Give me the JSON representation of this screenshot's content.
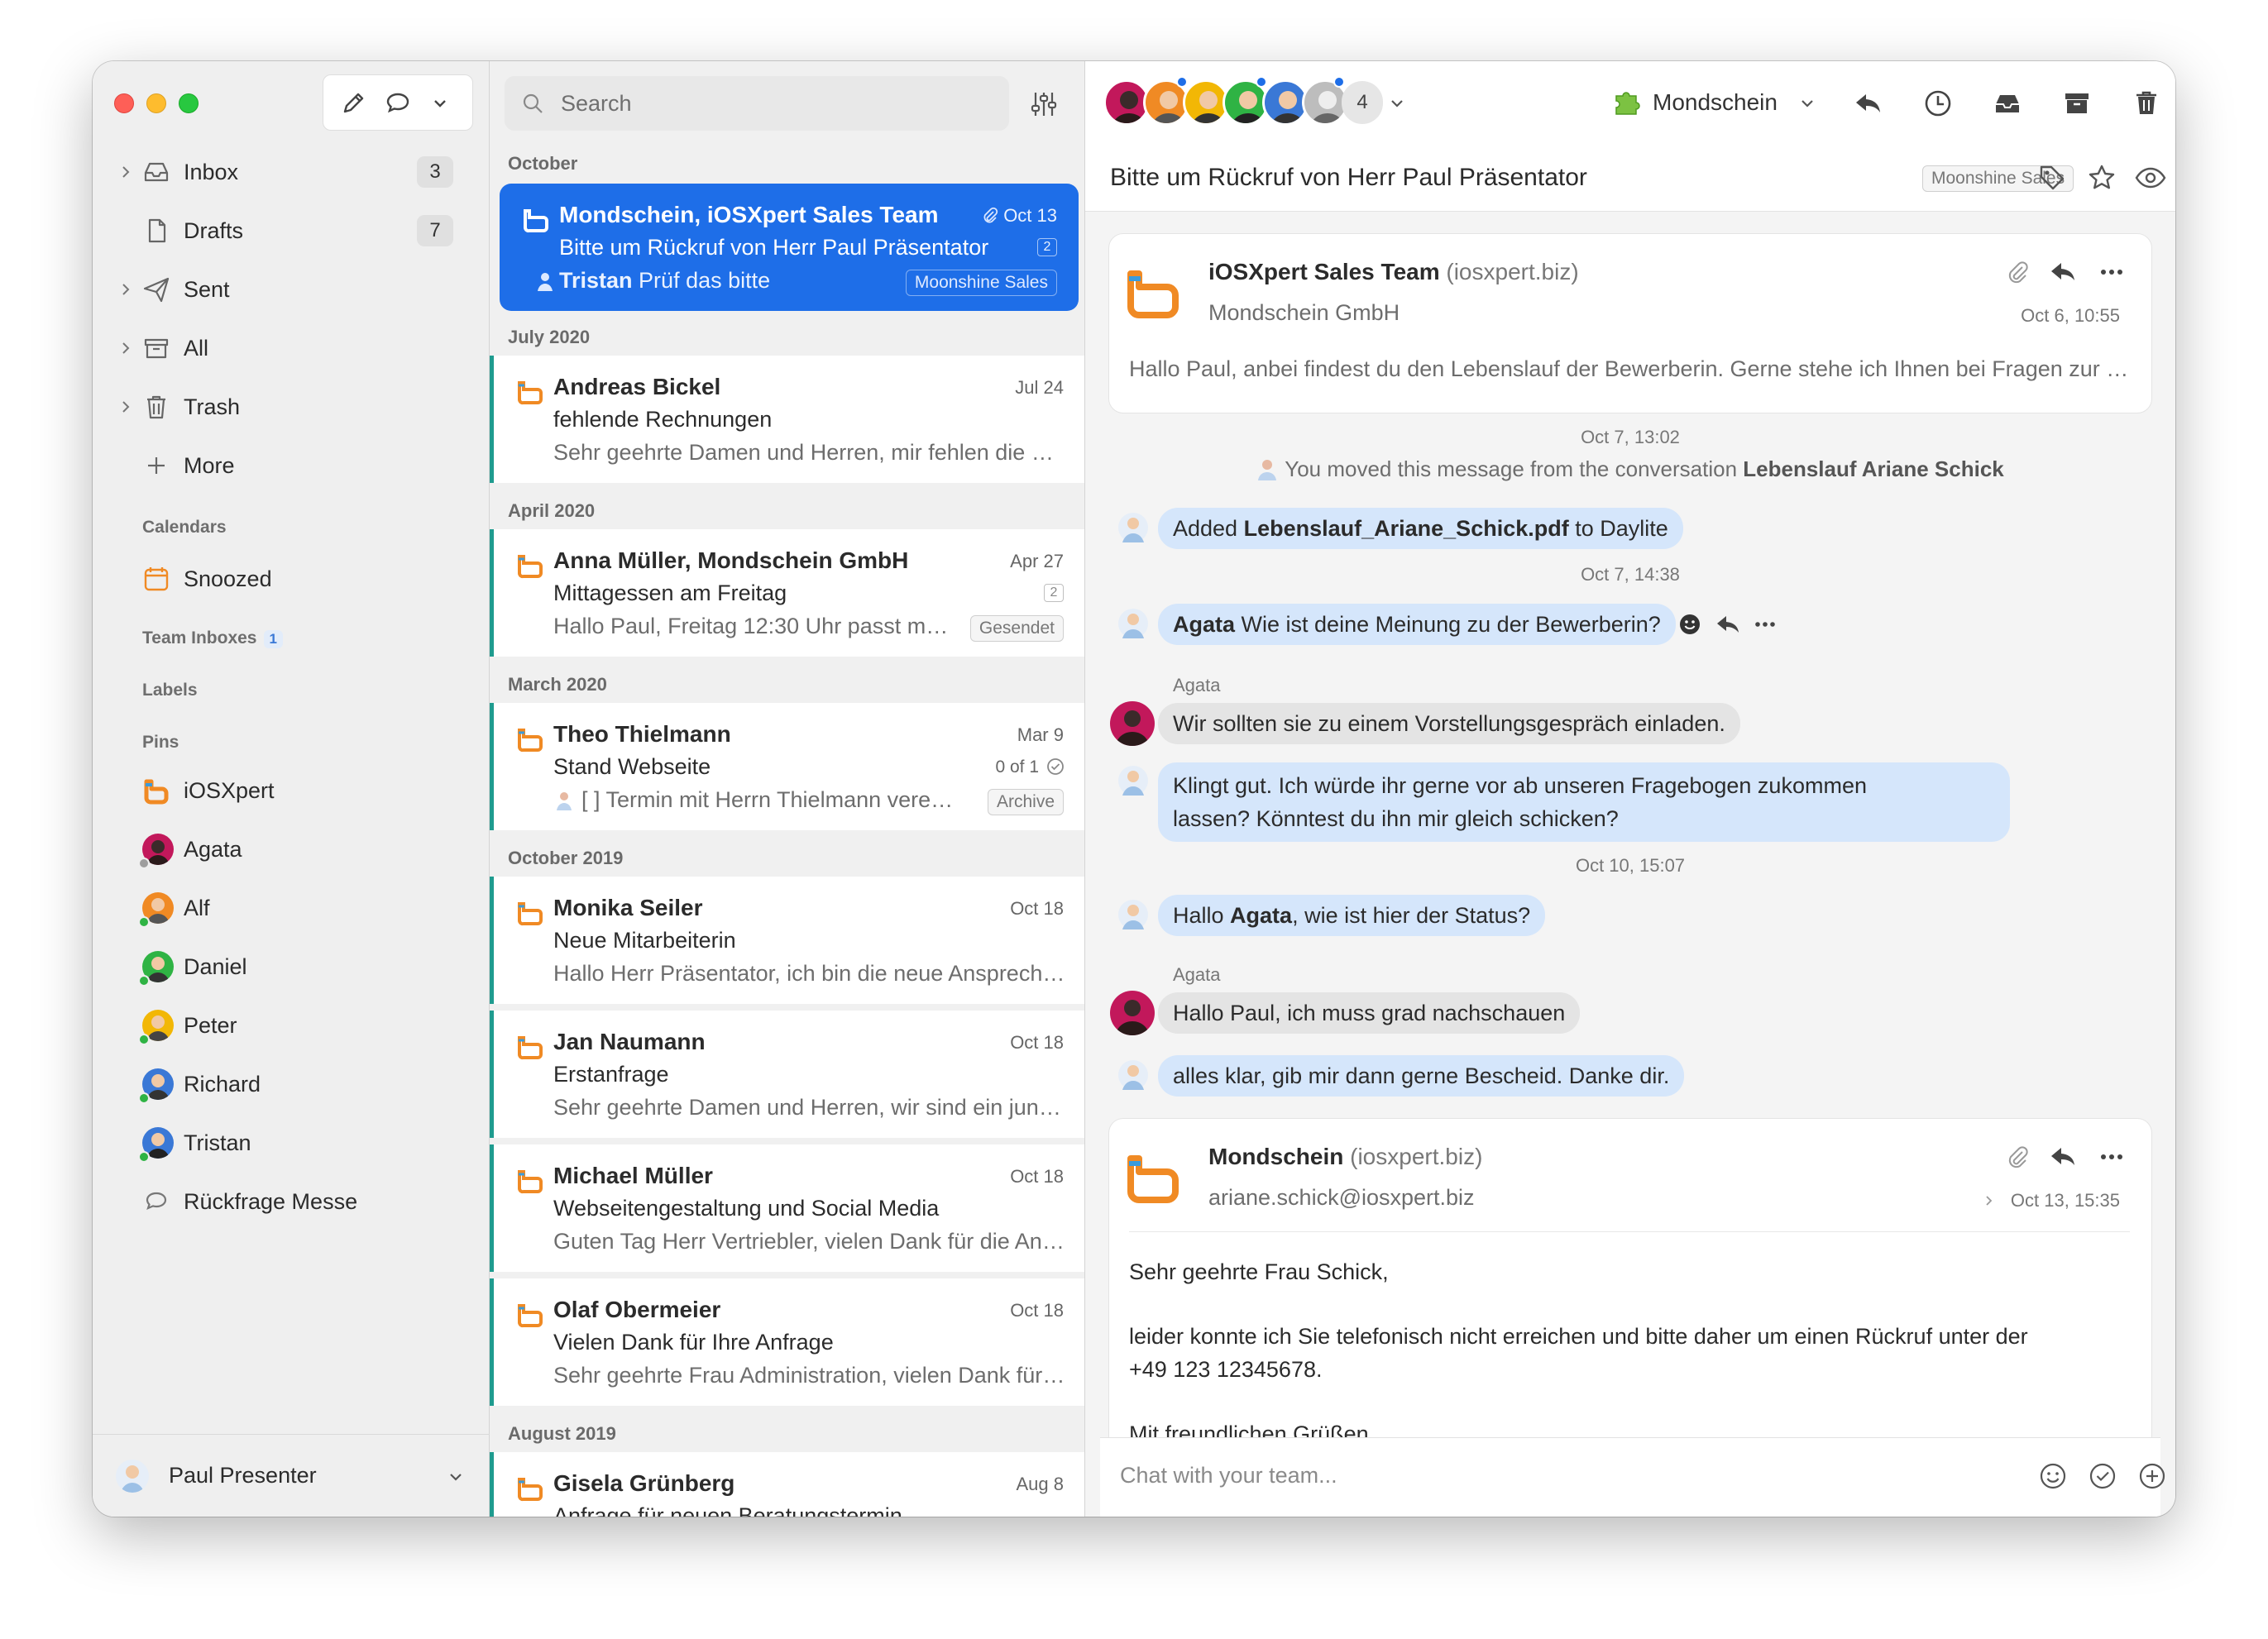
{
  "sidebar": {
    "items": [
      {
        "label": "Inbox",
        "count": "3"
      },
      {
        "label": "Drafts",
        "count": "7"
      },
      {
        "label": "Sent"
      },
      {
        "label": "All"
      },
      {
        "label": "Trash"
      },
      {
        "label": "More"
      }
    ],
    "calendars_heading": "Calendars",
    "snoozed": "Snoozed",
    "team_inboxes_heading": "Team Inboxes",
    "team_inboxes_count": "1",
    "labels_heading": "Labels",
    "pins_heading": "Pins",
    "pins": [
      "iOSXpert",
      "Agata",
      "Alf",
      "Daniel",
      "Peter",
      "Richard",
      "Tristan",
      "Rückfrage Messe"
    ],
    "user_name": "Paul Presenter"
  },
  "list": {
    "search_placeholder": "Search",
    "groups": [
      "October",
      "July 2020",
      "April 2020",
      "March 2020",
      "October 2019",
      "August 2019"
    ],
    "messages": [
      {
        "from": "Mondschein, iOSXpert Sales Team",
        "date": "Oct 13",
        "subject": "Bitte um Rückruf von Herr Paul Präsentator",
        "count": "2",
        "sender": "Tristan",
        "preview": "Prüf das bitte",
        "tag": "Moonshine Sales"
      },
      {
        "from": "Andreas Bickel",
        "date": "Jul 24",
        "subject": "fehlende Rechnungen",
        "preview": "Sehr geehrte Damen und Herren, mir fehlen die Rechnungen"
      },
      {
        "from": "Anna Müller, Mondschein GmbH",
        "date": "Apr 27",
        "subject": "Mittagessen am Freitag",
        "count": "2",
        "preview": "Hallo Paul, Freitag 12:30 Uhr passt mir gut",
        "tag": "Gesendet"
      },
      {
        "from": "Theo Thielmann",
        "date": "Mar 9",
        "subject": "Stand Webseite",
        "tasks": "0 of 1",
        "preview": "[ ] Termin mit Herrn Thielmann vereinbaren",
        "tag": "Archive"
      },
      {
        "from": "Monika Seiler",
        "date": "Oct 18",
        "subject": "Neue Mitarbeiterin",
        "preview": "Hallo Herr Präsentator, ich bin die neue Ansprechpartnerin"
      },
      {
        "from": "Jan Naumann",
        "date": "Oct 18",
        "subject": "Erstanfrage",
        "preview": "Sehr geehrte Damen und Herren, wir sind ein junges Unternehmen"
      },
      {
        "from": "Michael Müller",
        "date": "Oct 18",
        "subject": "Webseitengestaltung und Social Media",
        "preview": "Guten Tag Herr Vertriebler, vielen Dank für die Anfrage"
      },
      {
        "from": "Olaf Obermeier",
        "date": "Oct 18",
        "subject": "Vielen Dank für Ihre Anfrage",
        "preview": "Sehr geehrte Frau Administration, vielen Dank für Ihre Anfrage"
      },
      {
        "from": "Gisela Grünberg",
        "date": "Aug 8",
        "subject": "Anfrage für neuen Beratungstermin"
      }
    ]
  },
  "toolbar": {
    "extra_participants": "4",
    "workspace": "Mondschein"
  },
  "conversation": {
    "title": "Bitte um Rückruf von Herr Paul Präsentator",
    "tag": "Moonshine Sales",
    "email1": {
      "sender": "iOSXpert Sales Team",
      "domain": "(iosxpert.biz)",
      "company": "Mondschein GmbH",
      "date": "Oct 6, 10:55",
      "preview": "Hallo Paul, anbei findest du den Lebenslauf der Bewerberin. Gerne stehe ich Ihnen bei Fragen zur Verfügung."
    },
    "stamp1": "Oct 7, 13:02",
    "moved_prefix": "You moved this message from the conversation",
    "moved_conv": "Lebenslauf Ariane Schick",
    "added_prefix": "Added",
    "added_file": "Lebenslauf_Ariane_Schick.pdf",
    "added_suffix": "to Daylite",
    "stamp2": "Oct 7, 14:38",
    "msg_agata_name": "Agata",
    "msg_agata_q": "Wie ist deine Meinung zu der Bewerberin?",
    "agata_label": "Agata",
    "msg_agata_reply": "Wir sollten sie zu einem Vorstellungsgespräch einladen.",
    "msg_me_1a": "Klingt gut. Ich würde ihr gerne vor ab unseren Fragebogen zukommen",
    "msg_me_1b": "lassen? Könntest du ihn mir gleich schicken?",
    "stamp3": "Oct 10, 15:07",
    "msg_me_2_prefix": "Hallo",
    "msg_me_2_name": "Agata",
    "msg_me_2_suffix": ", wie ist hier der Status?",
    "agata_label2": "Agata",
    "msg_agata_2": "Hallo Paul, ich muss grad nachschauen",
    "msg_me_3": "alles klar, gib mir dann gerne Bescheid. Danke dir.",
    "email2": {
      "sender": "Mondschein",
      "domain": "(iosxpert.biz)",
      "to": "ariane.schick@iosxpert.biz",
      "date": "Oct 13, 15:35",
      "greeting": "Sehr geehrte Frau Schick,",
      "body_a": "leider konnte ich Sie telefonisch nicht erreichen und bitte daher um einen Rückruf unter der",
      "body_b": "+49 123 12345678.",
      "closing": "Mit freundlichen Grüßen"
    },
    "chat_placeholder": "Chat with your team..."
  },
  "colors": {
    "accent": "#1e6ee8",
    "brand_orange": "#f08a24",
    "thread_bar": "#1f9b8f",
    "bubble_me": "#d5e6fb"
  }
}
